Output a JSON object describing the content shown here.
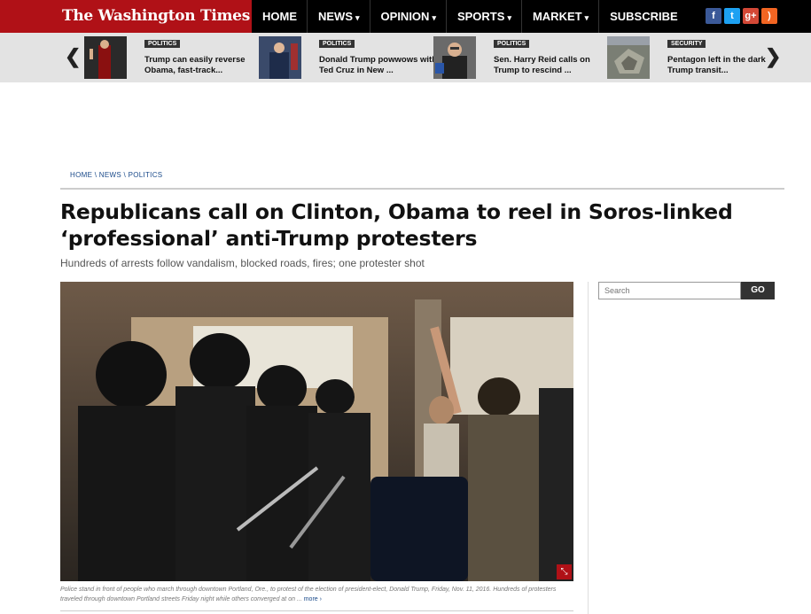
{
  "header": {
    "logo_text": "The Washington Times",
    "nav": [
      {
        "label": "HOME",
        "caret": ""
      },
      {
        "label": "NEWS",
        "caret": "▾"
      },
      {
        "label": "OPINION",
        "caret": "▾"
      },
      {
        "label": "SPORTS",
        "caret": "▾"
      },
      {
        "label": "MARKET",
        "caret": "▾"
      },
      {
        "label": "SUBSCRIBE",
        "caret": ""
      }
    ],
    "social_icons": [
      "facebook-icon",
      "twitter-icon",
      "google-plus-icon",
      "rss-icon"
    ],
    "social_glyphs": {
      "facebook": "f",
      "twitter": "t",
      "google_plus": "g+",
      "rss": ")"
    }
  },
  "strip": {
    "prev_glyph": "❮",
    "next_glyph": "❯",
    "stories": [
      {
        "category": "POLITICS",
        "title": "Trump can easily reverse Obama, fast-track..."
      },
      {
        "category": "POLITICS",
        "title": "Donald Trump powwows with Ted Cruz in New ..."
      },
      {
        "category": "POLITICS",
        "title": "Sen. Harry Reid calls on Trump to rescind ..."
      },
      {
        "category": "SECURITY",
        "title": "Pentagon left in the dark Trump transit..."
      }
    ]
  },
  "breadcrumb": {
    "home": "HOME",
    "sep1": " \\ ",
    "news": "NEWS",
    "sep2": " \\ ",
    "politics": "POLITICS"
  },
  "article": {
    "headline": "Republicans call on Clinton, Obama to reel in Soros-linked ‘professional’ anti-Trump protesters",
    "subhead": "Hundreds of arrests follow vandalism, blocked roads, fires; one protester shot",
    "caption": "Police stand in front of people who march through downtown Portland, Ore., to protest of the election of president-elect, Donald Trump, Friday, Nov. 11, 2016. Hundreds of protesters traveled through downtown Portland streets Friday night while others converged at on ... ",
    "caption_more": "more ›",
    "enlarge_glyph": "⤡"
  },
  "sidebar": {
    "search_placeholder": "Search",
    "search_button": "GO"
  },
  "colors": {
    "brand_red": "#b01117",
    "nav_bg": "#000000",
    "strip_bg": "#e3e3e3",
    "link_blue": "#1a4a8a"
  }
}
